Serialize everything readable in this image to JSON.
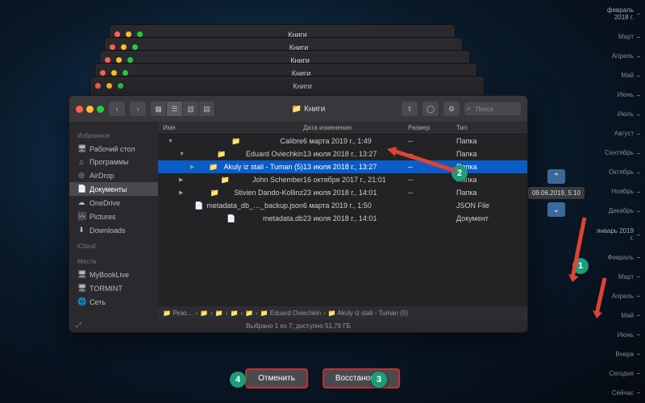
{
  "window_title": "Книги",
  "stacked_title": "Книги",
  "search_placeholder": "Поиск",
  "sidebar": {
    "sections": [
      {
        "header": "Избранное",
        "items": [
          {
            "icon": "🖥",
            "label": "Рабочий стол"
          },
          {
            "icon": "⌂",
            "label": "Программы"
          },
          {
            "icon": "◎",
            "label": "AirDrop"
          },
          {
            "icon": "📄",
            "label": "Документы",
            "active": true
          },
          {
            "icon": "☁",
            "label": "OneDrive"
          },
          {
            "icon": "🖼",
            "label": "Pictures"
          },
          {
            "icon": "⬇",
            "label": "Downloads"
          }
        ]
      },
      {
        "header": "iCloud",
        "items": []
      },
      {
        "header": "Места",
        "items": [
          {
            "icon": "🖥",
            "label": "MyBookLive"
          },
          {
            "icon": "🖥",
            "label": "TORMINT"
          },
          {
            "icon": "🌐",
            "label": "Сеть"
          }
        ]
      }
    ]
  },
  "columns": [
    "Имя",
    "Дата изменения",
    "Размер",
    "Тип"
  ],
  "rows": [
    {
      "indent": 0,
      "tri": "▼",
      "ficon": "📁",
      "name": "Calibre",
      "date": "6 марта 2019 г., 1:49",
      "size": "--",
      "type": "Папка"
    },
    {
      "indent": 1,
      "tri": "▼",
      "ficon": "📁",
      "name": "Eduard Oviechkin",
      "date": "13 июля 2018 г., 13:27",
      "size": "--",
      "type": "Папка"
    },
    {
      "indent": 2,
      "tri": "▶",
      "ficon": "📁",
      "name": "Akuly iz stali - Tuman (5)",
      "date": "13 июля 2018 г., 13:27",
      "size": "--",
      "type": "Папка",
      "selected": true
    },
    {
      "indent": 1,
      "tri": "▶",
      "ficon": "📁",
      "name": "John Schember",
      "date": "16 октября 2017 г., 21:01",
      "size": "--",
      "type": "Папка"
    },
    {
      "indent": 1,
      "tri": "▶",
      "ficon": "📁",
      "name": "Stivien Dando-Kollinz",
      "date": "23 июля 2018 г., 14:01",
      "size": "--",
      "type": "Папка"
    },
    {
      "indent": 1,
      "tri": "",
      "ficon": "📄",
      "name": "metadata_db_…_backup.json",
      "date": "6 марта 2019 г., 1:50",
      "size": "",
      "type": "JSON File"
    },
    {
      "indent": 1,
      "tri": "",
      "ficon": "📄",
      "name": "metadata.db",
      "date": "23 июля 2018 г., 14:01",
      "size": "",
      "type": "Документ"
    }
  ],
  "path": [
    "Резо…",
    "",
    "",
    "",
    "",
    "Eduard Oviechkin",
    "Akuly iz stali - Tuman (5)"
  ],
  "status": "Выбрано 1 из 7; доступно 51,79 ГБ",
  "snapshot_date": "09.06.2019, 5:10",
  "timeline": [
    "февраль 2018 г.",
    "Март",
    "Апрель",
    "Май",
    "Июнь",
    "Июль",
    "Август",
    "Сентябрь",
    "Октябрь",
    "Ноябрь",
    "Декабрь",
    "январь 2019 г.",
    "Февраль",
    "Март",
    "Апрель",
    "Май",
    "Июнь",
    "Вчера",
    "Сегодня",
    "Сейчас"
  ],
  "buttons": {
    "cancel": "Отменить",
    "restore": "Восстановить"
  },
  "badges": {
    "b1": "1",
    "b2": "2",
    "b3": "3",
    "b4": "4"
  }
}
